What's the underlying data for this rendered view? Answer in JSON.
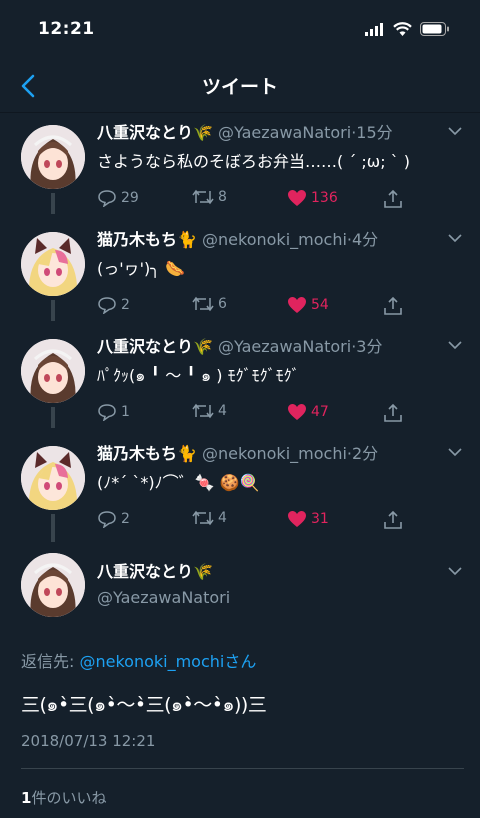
{
  "status_bar": {
    "time": "12:21"
  },
  "nav": {
    "title": "ツイート"
  },
  "colors": {
    "background": "#15202b",
    "accent": "#1da1f2",
    "like": "#e0245e",
    "muted": "#8899a6"
  },
  "tweets": [
    {
      "name": "八重沢なとり",
      "emoji": "🌾",
      "handle": "@YaezawaNatori",
      "time": "15分",
      "text": "さようなら私のそぼろお弁当……( ´ ;ω; ` )",
      "replies": "29",
      "retweets": "8",
      "likes": "136"
    },
    {
      "name": "猫乃木もち",
      "emoji": "🐈",
      "handle": "@nekonoki_mochi",
      "time": "4分",
      "text": "(っ'ヮ')╮ 🌭",
      "replies": "2",
      "retweets": "6",
      "likes": "54"
    },
    {
      "name": "八重沢なとり",
      "emoji": "🌾",
      "handle": "@YaezawaNatori",
      "time": "3分",
      "text": "ﾊﾟｸｯ(๑ ╹ ～ ╹ ๑ ) ﾓｸﾞﾓｸﾞﾓｸﾞ",
      "replies": "1",
      "retweets": "4",
      "likes": "47"
    },
    {
      "name": "猫乃木もち",
      "emoji": "🐈",
      "handle": "@nekonoki_mochi",
      "time": "2分",
      "text": "(ﾉ*´ `*)ﾉ⌒゛🍬 🍪🍭",
      "replies": "2",
      "retweets": "4",
      "likes": "31"
    }
  ],
  "main_tweet": {
    "name": "八重沢なとり",
    "emoji": "🌾",
    "handle": "@YaezawaNatori",
    "reply_prefix": "返信先: ",
    "reply_mention": "@nekonoki_mochi",
    "reply_suffix": "さん",
    "text": "三(๑•̀三(๑•̀～•̀三(๑•̀～•̀๑))三",
    "timestamp": "2018/07/13 12:21",
    "likes_count": "1",
    "likes_label": "件のいいね"
  }
}
